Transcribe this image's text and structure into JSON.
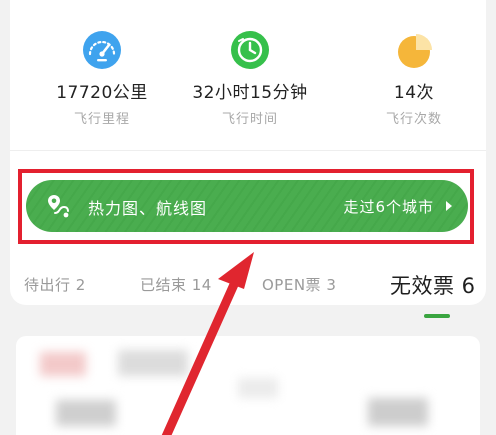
{
  "stats": [
    {
      "icon": "speedometer-icon",
      "value": "17720公里",
      "label": "飞行里程"
    },
    {
      "icon": "clock-icon",
      "value": "32小时15分钟",
      "label": "飞行时间"
    },
    {
      "icon": "pie-chart-icon",
      "value": "14次",
      "label": "飞行次数"
    }
  ],
  "banner": {
    "icon": "map-route-icon",
    "title": "热力图、航线图",
    "cities": "走过6个城市"
  },
  "tabs": [
    {
      "label": "待出行 2"
    },
    {
      "label": "已结束 14"
    },
    {
      "label": "OPEN票 3"
    },
    {
      "label": "无效票 6"
    }
  ],
  "active_tab": 3,
  "colors": {
    "green": "#4aad4f",
    "highlight_red": "#e3202f",
    "arrow_red": "#e0262f",
    "speedometer_blue": "#3fa3ee",
    "clock_green": "#36c04b",
    "pie_orange": "#f5b63a"
  }
}
